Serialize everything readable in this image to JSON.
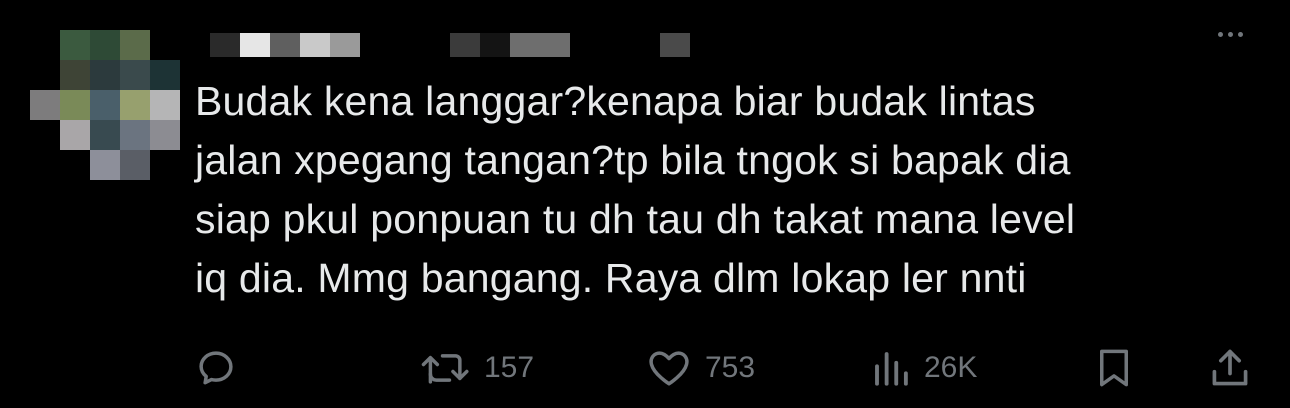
{
  "tweet": {
    "text": "Budak kena langgar?kenapa biar budak lintas\njalan xpegang tangan?tp bila tngok si bapak dia\nsiap pkul ponpuan tu dh tau dh takat mana level\niq dia. Mmg bangang. Raya dlm lokap ler nnti"
  },
  "actions": {
    "reply": {
      "icon": "reply-icon",
      "count": ""
    },
    "retweet": {
      "icon": "retweet-icon",
      "count": "157"
    },
    "like": {
      "icon": "heart-icon",
      "count": "753"
    },
    "views": {
      "icon": "views-icon",
      "count": "26K"
    },
    "bookmark": {
      "icon": "bookmark-icon"
    },
    "share": {
      "icon": "share-icon"
    }
  },
  "colors": {
    "background": "#000000",
    "text": "#e7e9ea",
    "muted": "#71767b"
  }
}
